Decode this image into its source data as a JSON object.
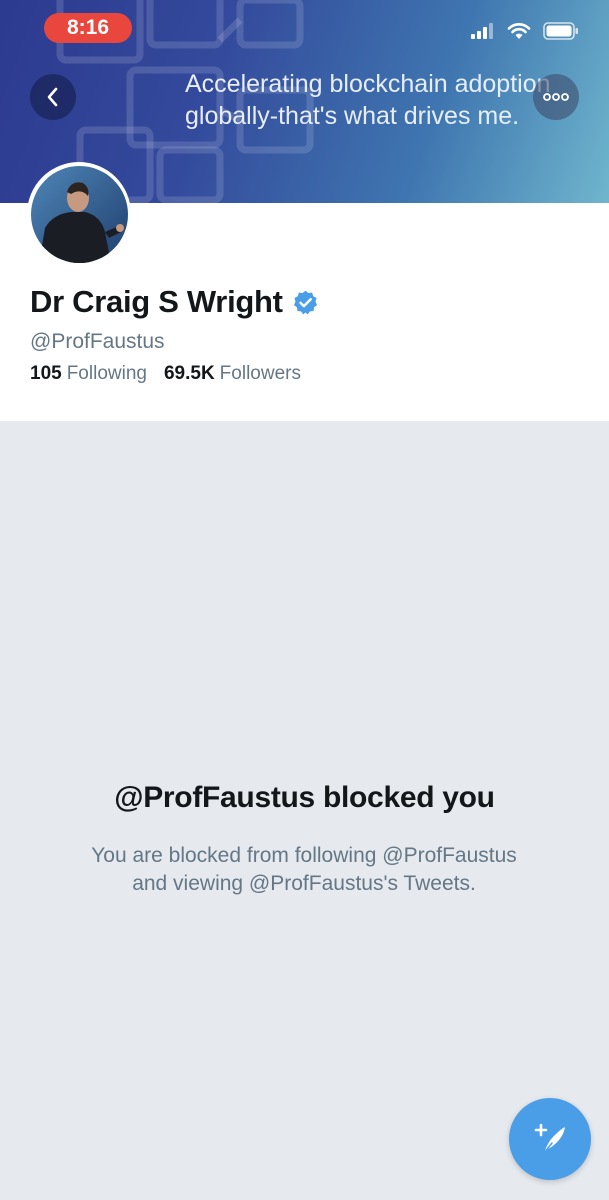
{
  "status_bar": {
    "time": "8:16"
  },
  "banner": {
    "line1": "Accelerating blockchain adoption",
    "line2": "globally-that's what drives me."
  },
  "profile": {
    "name": "Dr Craig S Wright",
    "handle": "@ProfFaustus",
    "following_count": "105",
    "following_label": "Following",
    "followers_count": "69.5K",
    "followers_label": "Followers",
    "verified": true
  },
  "blocked": {
    "title": "@ProfFaustus blocked you",
    "description_line1": "You are blocked from following @ProfFaustus",
    "description_line2": "and viewing @ProfFaustus's Tweets."
  },
  "colors": {
    "accent": "#4a9ee8",
    "time_pill": "#e9473d",
    "page_bg": "#e6e9ee"
  },
  "icons": {
    "back": "chevron-left-icon",
    "more": "more-dots-icon",
    "verified": "verified-badge-icon",
    "compose": "compose-tweet-icon",
    "signal": "signal-icon",
    "wifi": "wifi-icon",
    "battery": "battery-icon"
  }
}
